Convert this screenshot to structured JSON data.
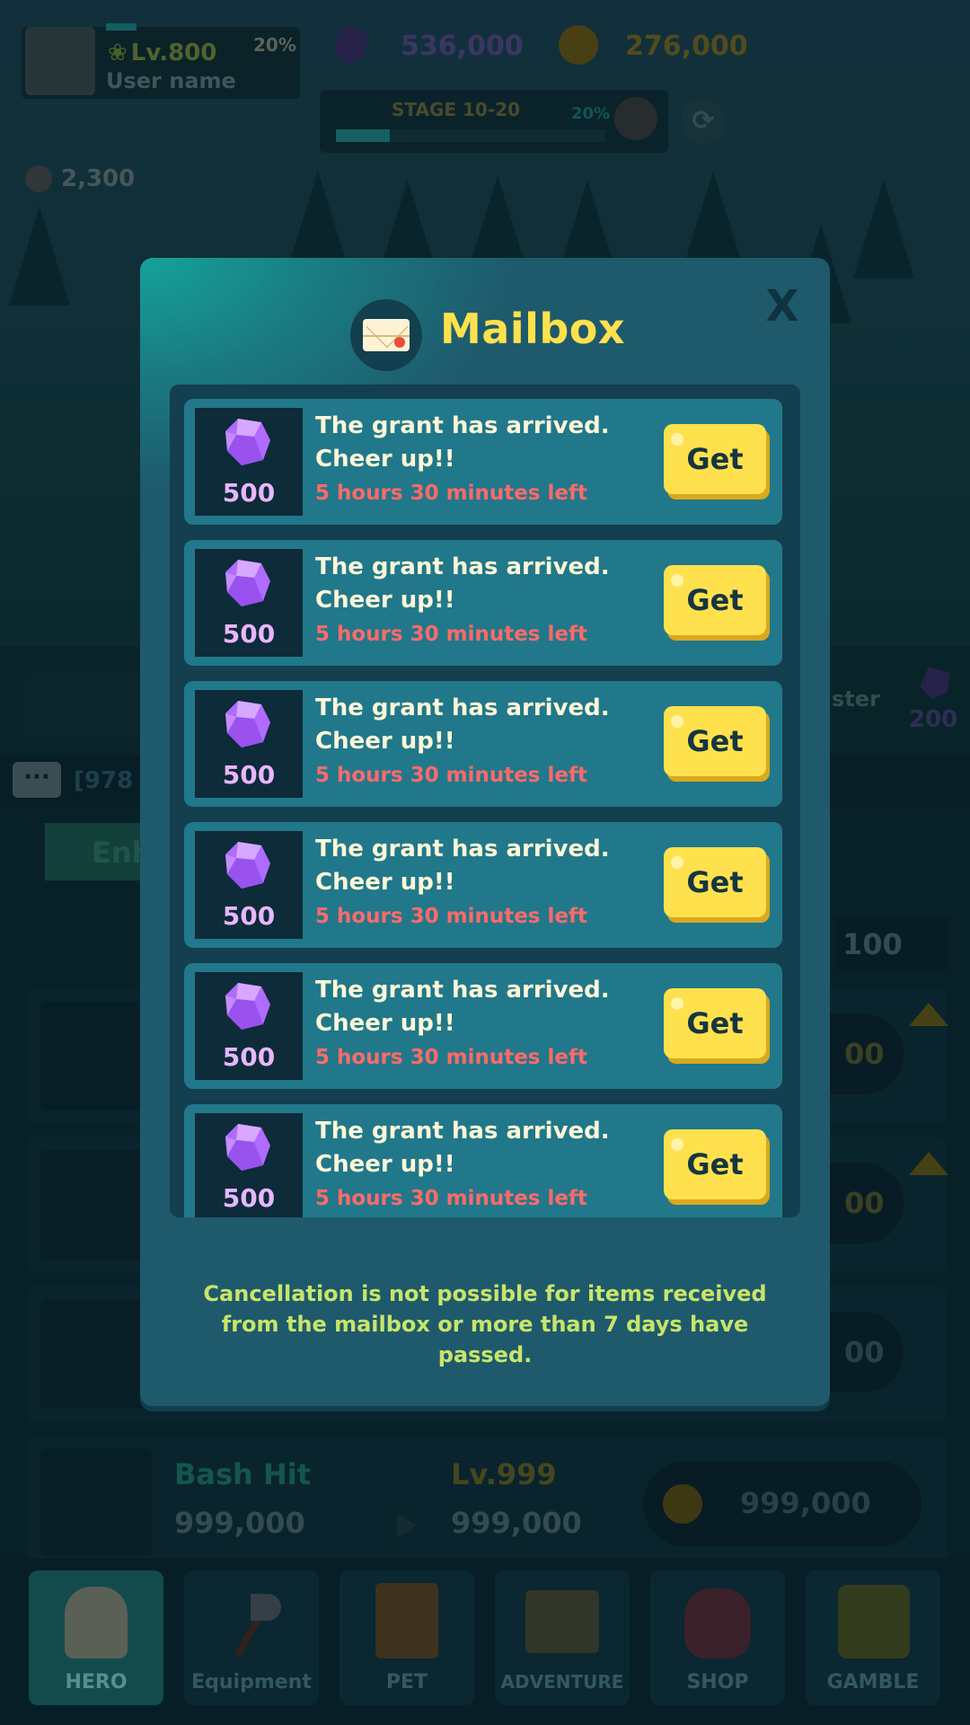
{
  "hud": {
    "level": "Lv.800",
    "username": "User name",
    "xp_percent": "20%",
    "gems": "536,000",
    "coins": "276,000",
    "stage": "STAGE 10-20",
    "stage_percent": "20%",
    "stage_progress": 0.2,
    "skulls": "2,300"
  },
  "background": {
    "chat_text": "[978",
    "tab_enhance": "Enh",
    "monster_label": "ster",
    "monster_gems": "200",
    "top_value": "100",
    "row_values": [
      "00",
      "00",
      "00"
    ],
    "skill": {
      "name": "Bash Hit",
      "level": "Lv.999",
      "current": "999,000",
      "next": "999,000",
      "cost": "999,000"
    }
  },
  "modal": {
    "title": "Mailbox",
    "close_label": "X",
    "notice": "Cancellation is not possible for items received from the mailbox or more than 7 days have passed.",
    "items": [
      {
        "amount": "500",
        "message": "The grant has arrived. Cheer up!!",
        "time_left": "5 hours 30 minutes left",
        "button": "Get"
      },
      {
        "amount": "500",
        "message": "The grant has arrived. Cheer up!!",
        "time_left": "5 hours 30 minutes left",
        "button": "Get"
      },
      {
        "amount": "500",
        "message": "The grant has arrived. Cheer up!!",
        "time_left": "5 hours 30 minutes left",
        "button": "Get"
      },
      {
        "amount": "500",
        "message": "The grant has arrived. Cheer up!!",
        "time_left": "5 hours 30 minutes left",
        "button": "Get"
      },
      {
        "amount": "500",
        "message": "The grant has arrived. Cheer up!!",
        "time_left": "5 hours 30 minutes left",
        "button": "Get"
      },
      {
        "amount": "500",
        "message": "The grant has arrived. Cheer up!!",
        "time_left": "5 hours 30 minutes left",
        "button": "Get"
      }
    ]
  },
  "nav": [
    {
      "label": "HERO",
      "icon": "hero-icon",
      "active": true
    },
    {
      "label": "Equipment",
      "icon": "axe-icon",
      "active": false
    },
    {
      "label": "PET",
      "icon": "pet-icon",
      "active": false
    },
    {
      "label": "ADVENTURE",
      "icon": "map-icon",
      "active": false
    },
    {
      "label": "SHOP",
      "icon": "pouch-icon",
      "active": false
    },
    {
      "label": "GAMBLE",
      "icon": "dice-icon",
      "active": false
    }
  ],
  "colors": {
    "accent_yellow": "#ffe14d",
    "gem_purple": "#b06bff",
    "warning_red": "#ff6a6a",
    "notice_green": "#c9e46a",
    "modal_bg": "#1e5a6c"
  }
}
